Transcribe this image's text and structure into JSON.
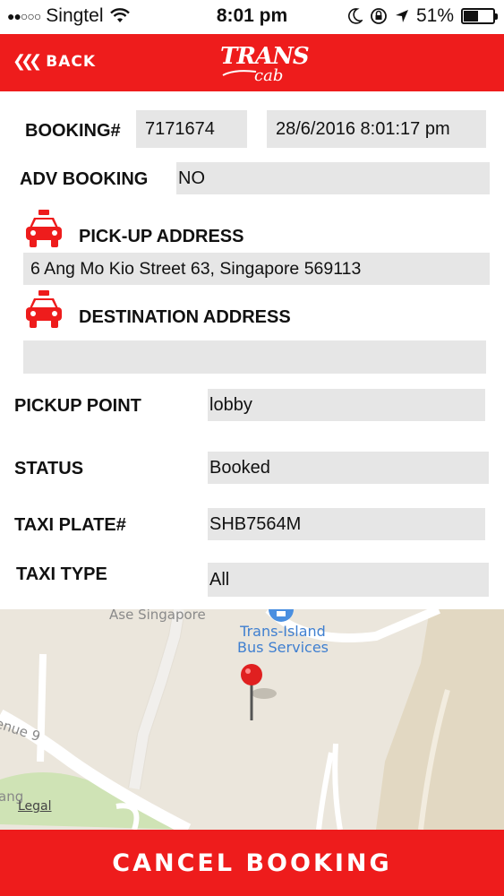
{
  "status_bar": {
    "carrier": "Singtel",
    "time": "8:01 pm",
    "battery": "51%",
    "battery_level": 0.51
  },
  "header": {
    "back_label": "BACK",
    "logo_line1": "TRANS",
    "logo_line2": "cab",
    "background_color": "#ee1c1c"
  },
  "booking": {
    "booking_label": "BOOKING#",
    "booking_number": "7171674",
    "booking_datetime": "28/6/2016 8:01:17 pm",
    "adv_booking_label": "ADV BOOKING",
    "adv_booking_value": "NO",
    "pickup_address_label": "PICK-UP ADDRESS",
    "pickup_address_value": "6 Ang Mo Kio Street 63, Singapore 569113",
    "destination_address_label": "DESTINATION ADDRESS",
    "destination_address_value": "",
    "pickup_point_label": "PICKUP POINT",
    "pickup_point_value": "lobby",
    "status_label": "STATUS",
    "status_value": "Booked",
    "taxi_plate_label": "TAXI PLATE#",
    "taxi_plate_value": "SHB7564M",
    "taxi_type_label": "TAXI TYPE",
    "taxi_type_value": "All"
  },
  "map": {
    "place_label_1": "Ase Singapore",
    "poi_label_line1": "Trans-Island",
    "poi_label_line2": "Bus Services",
    "street_label": "enue 9",
    "area_label": "ang",
    "legal_label": "Legal"
  },
  "footer": {
    "cancel_label": "CANCEL BOOKING"
  },
  "icons": [
    "wifi-icon",
    "moon-icon",
    "orientation-lock-icon",
    "location-arrow-icon",
    "battery-icon",
    "back-chevron-icon",
    "taxi-icon",
    "map-pin-icon",
    "bus-stop-icon"
  ]
}
